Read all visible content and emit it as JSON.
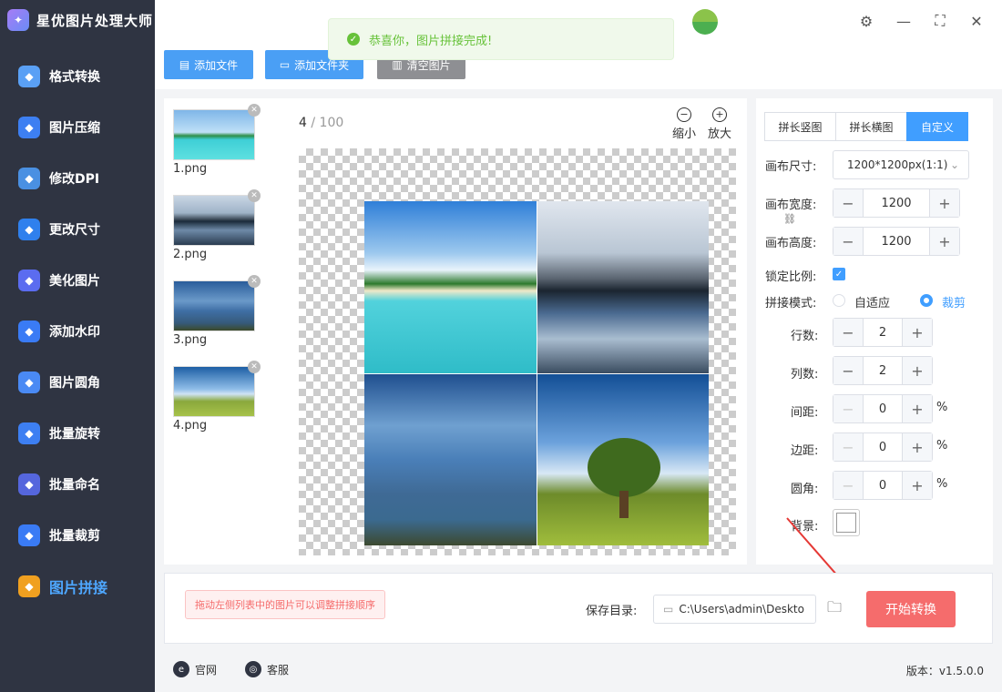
{
  "app": {
    "title": "星优图片处理大师"
  },
  "sidebar": {
    "items": [
      {
        "label": "格式转换",
        "icon": "format-convert-icon",
        "color": "#5aa0f5"
      },
      {
        "label": "图片压缩",
        "icon": "compress-icon",
        "color": "#3d7ff2"
      },
      {
        "label": "修改DPI",
        "icon": "dpi-icon",
        "color": "#4a90e2"
      },
      {
        "label": "更改尺寸",
        "icon": "resize-icon",
        "color": "#2f80ed"
      },
      {
        "label": "美化图片",
        "icon": "beautify-icon",
        "color": "#5b6cf0"
      },
      {
        "label": "添加水印",
        "icon": "watermark-icon",
        "color": "#3a7bf5"
      },
      {
        "label": "图片圆角",
        "icon": "round-corner-icon",
        "color": "#4a8af4"
      },
      {
        "label": "批量旋转",
        "icon": "rotate-icon",
        "color": "#3d7ff2"
      },
      {
        "label": "批量命名",
        "icon": "rename-icon",
        "color": "#5566dd"
      },
      {
        "label": "批量裁剪",
        "icon": "crop-icon",
        "color": "#3a7bf5"
      },
      {
        "label": "图片拼接",
        "icon": "stitch-icon",
        "color": "#f0a020",
        "active": true
      }
    ]
  },
  "toolbar": {
    "add_file": "添加文件",
    "add_folder": "添加文件夹",
    "clear": "清空图片"
  },
  "toast": {
    "text": "恭喜你，图片拼接完成!"
  },
  "files": [
    {
      "name": "1.png"
    },
    {
      "name": "2.png"
    },
    {
      "name": "3.png"
    },
    {
      "name": "4.png"
    }
  ],
  "preview": {
    "counter_current": "4",
    "counter_sep": " / ",
    "counter_total": "100",
    "zoom_out": "缩小",
    "zoom_in": "放大"
  },
  "settings": {
    "tabs": [
      "拼长竖图",
      "拼长横图",
      "自定义"
    ],
    "active_tab": "自定义",
    "canvas_size_label": "画布尺寸:",
    "canvas_size_value": "1200*1200px(1:1)",
    "canvas_width_label": "画布宽度:",
    "canvas_width": "1200",
    "canvas_height_label": "画布高度:",
    "canvas_height": "1200",
    "lock_ratio_label": "锁定比例:",
    "mode_label": "拼接模式:",
    "mode_options": [
      "自适应",
      "裁剪"
    ],
    "mode_selected": "裁剪",
    "rows_label": "行数:",
    "rows": "2",
    "cols_label": "列数:",
    "cols": "2",
    "gap_label": "间距:",
    "gap": "0",
    "margin_label": "边距:",
    "margin": "0",
    "radius_label": "圆角:",
    "radius": "0",
    "percent": "%",
    "bg_label": "背景:"
  },
  "bottom": {
    "hint": "拖动左侧列表中的图片可以调整拼接顺序",
    "save_label": "保存目录:",
    "save_path": "C:\\Users\\admin\\Deskto",
    "start": "开始转换"
  },
  "footer": {
    "website": "官网",
    "support": "客服",
    "version": "版本：v1.5.0.0"
  }
}
